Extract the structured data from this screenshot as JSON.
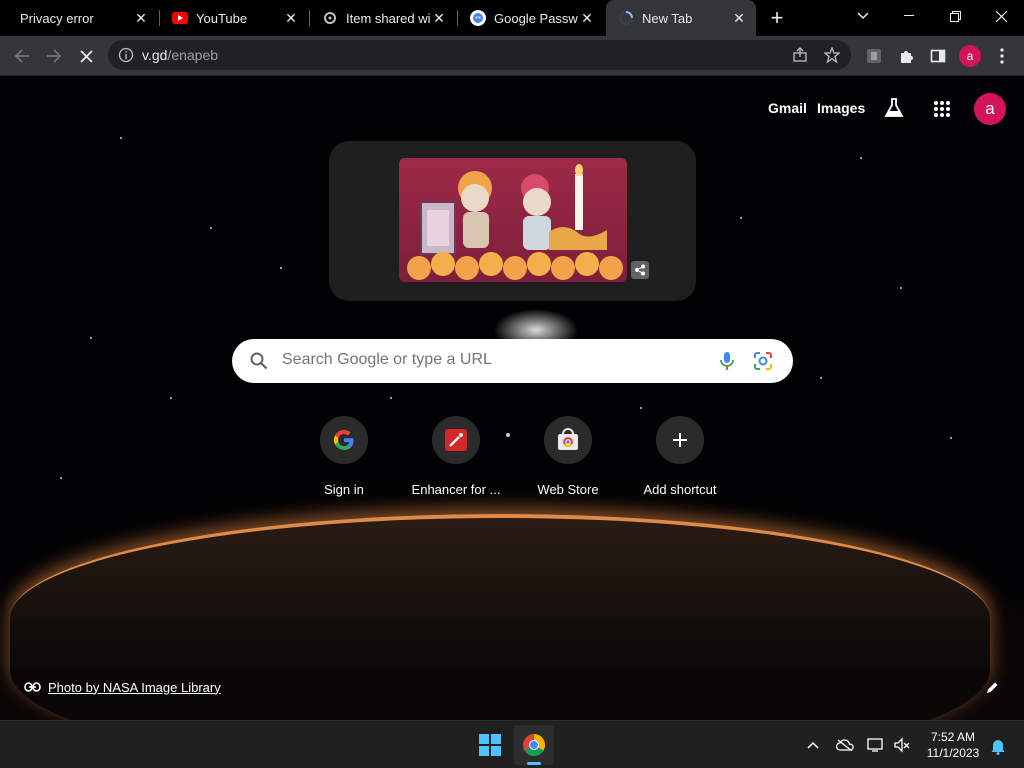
{
  "tabs": [
    {
      "title": "Privacy error",
      "icon": "warning-icon",
      "active": false
    },
    {
      "title": "YouTube",
      "icon": "youtube-icon",
      "active": false
    },
    {
      "title": "Item shared wit",
      "icon": "link-icon",
      "active": false
    },
    {
      "title": "Google Passwo",
      "icon": "google-password-icon",
      "active": false
    },
    {
      "title": "New Tab",
      "icon": "loading-spinner-icon",
      "active": true
    }
  ],
  "toolbar": {
    "url_host": "v.gd",
    "url_path": "/enapeb",
    "profile_initial": "a"
  },
  "ntp": {
    "gmail_label": "Gmail",
    "images_label": "Images",
    "profile_initial": "a",
    "search_placeholder": "Search Google or type a URL",
    "shortcuts": [
      {
        "label": "Sign in",
        "icon": "google-g-icon"
      },
      {
        "label": "Enhancer for ...",
        "icon": "enhancer-wand-icon"
      },
      {
        "label": "Web Store",
        "icon": "chrome-web-store-icon"
      },
      {
        "label": "Add shortcut",
        "icon": "plus-icon"
      }
    ],
    "attribution": "Photo by NASA Image Library"
  },
  "taskbar": {
    "time": "7:52 AM",
    "date": "11/1/2023"
  },
  "colors": {
    "accent": "#d4145a",
    "tab_active_bg": "#35363a",
    "toolbar_bg": "#35363a",
    "taskbar_bg": "#202020"
  }
}
